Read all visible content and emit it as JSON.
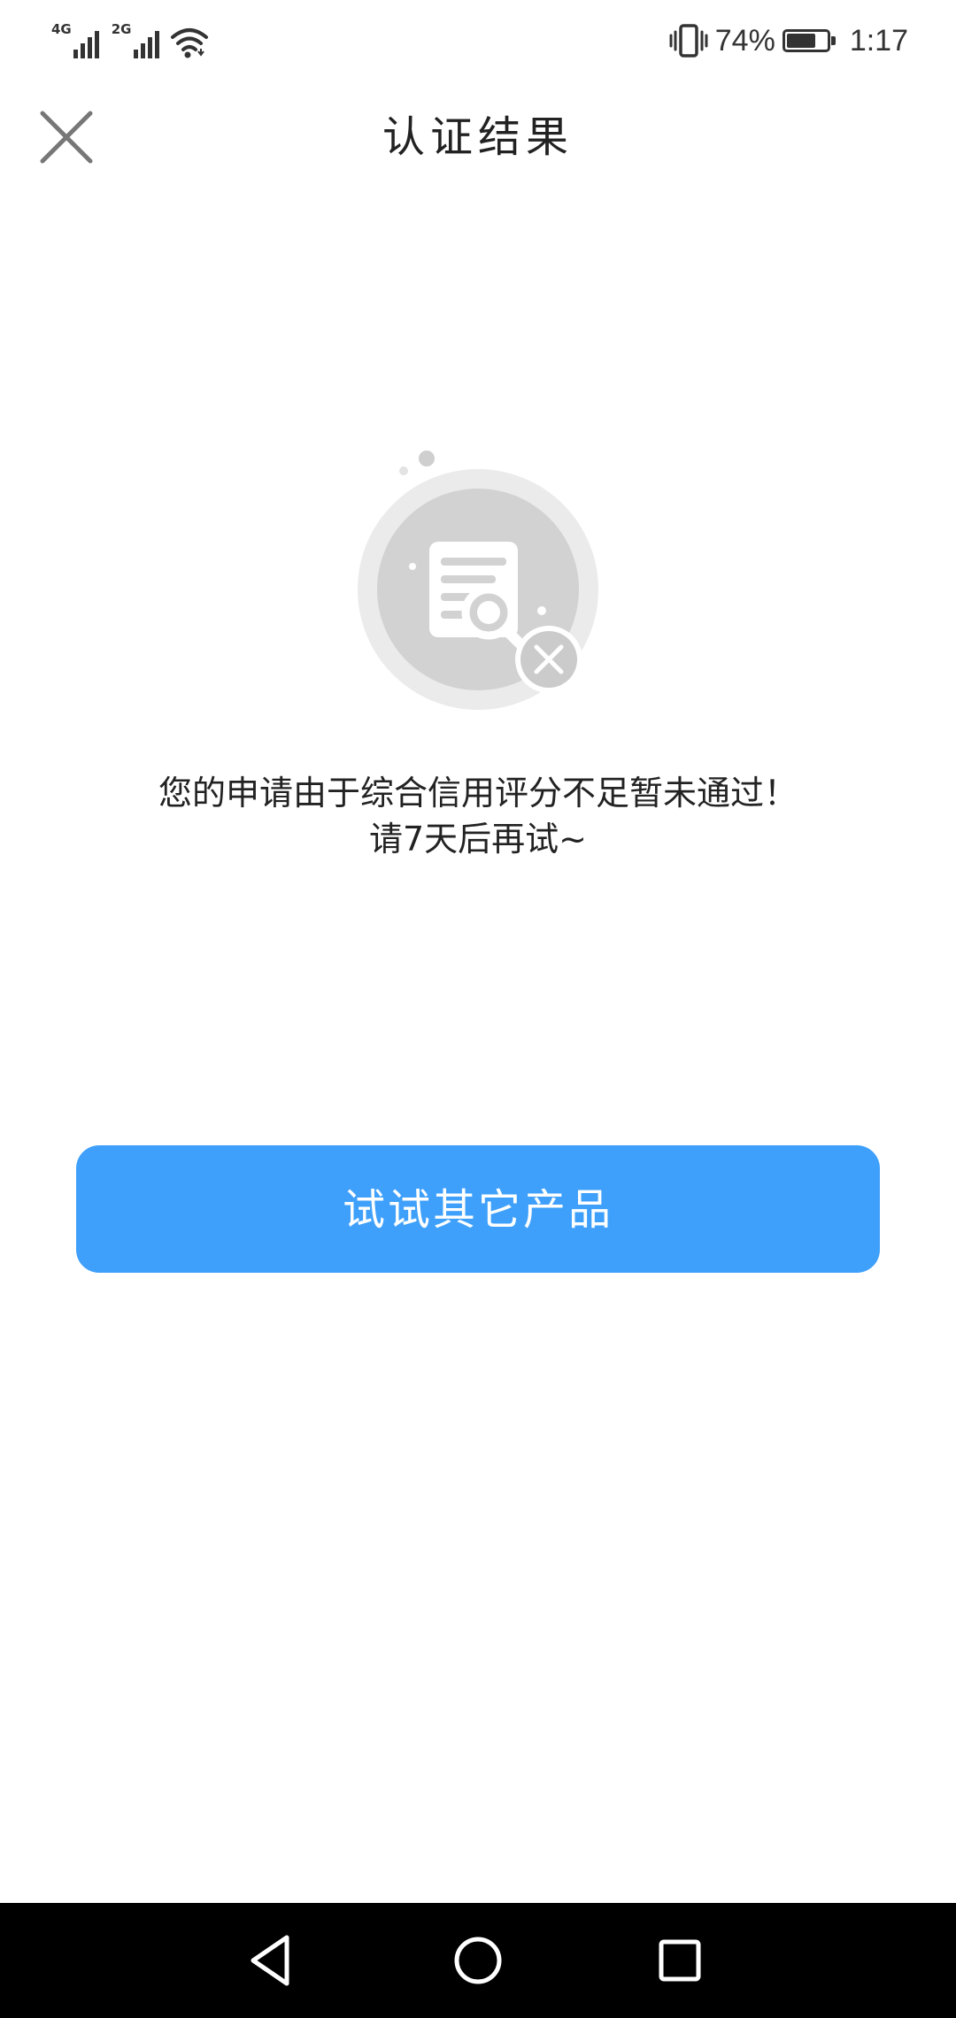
{
  "status_bar": {
    "network_1": "4G",
    "network_2": "2G",
    "battery_percent": "74%",
    "battery_level": 0.74,
    "time": "1:17",
    "icons": [
      "signal-icon",
      "wifi-icon",
      "vibrate-icon",
      "battery-icon"
    ]
  },
  "header": {
    "title": "认证结果",
    "close_icon": "close-icon"
  },
  "illustration": {
    "icon": "document-search-rejected-icon"
  },
  "message": {
    "line1": "您的申请由于综合信用评分不足暂未通过！",
    "line2": "请7天后再试~"
  },
  "actions": {
    "primary_label": "试试其它产品"
  },
  "colors": {
    "primary": "#3fa0fb",
    "text": "#222222",
    "illustration_gray": "#d0d0d0"
  },
  "nav_bar": {
    "icons": [
      "back-icon",
      "home-icon",
      "recents-icon"
    ]
  }
}
